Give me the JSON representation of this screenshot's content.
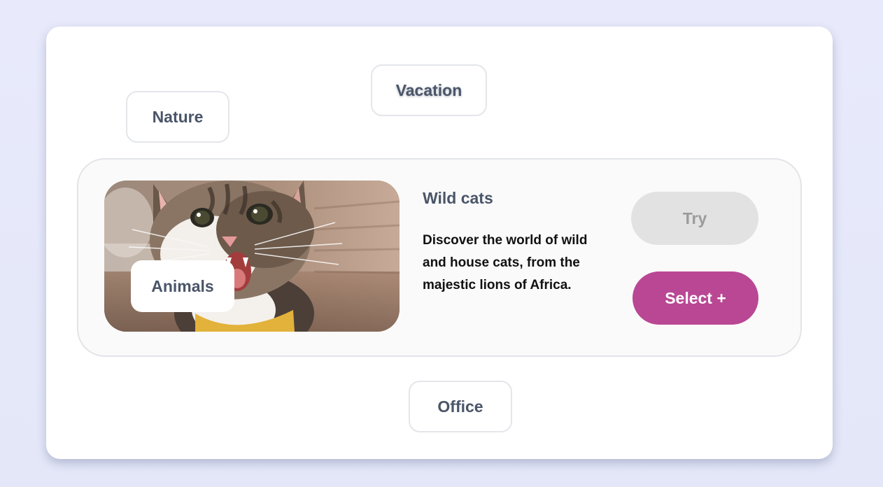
{
  "tags": {
    "nature": "Nature",
    "vacation": "Vacation",
    "animals": "Animals",
    "office": "Office"
  },
  "card": {
    "title": "Wild cats",
    "description": "Discover the world of wild and house cats, from the majestic lions of Africa.",
    "try_label": "Try",
    "select_label": "Select +"
  },
  "colors": {
    "select_button": "#b94794",
    "try_button_disabled": "#e2e2e2",
    "chip_text": "#4a5568",
    "background": "#e8eafb"
  }
}
